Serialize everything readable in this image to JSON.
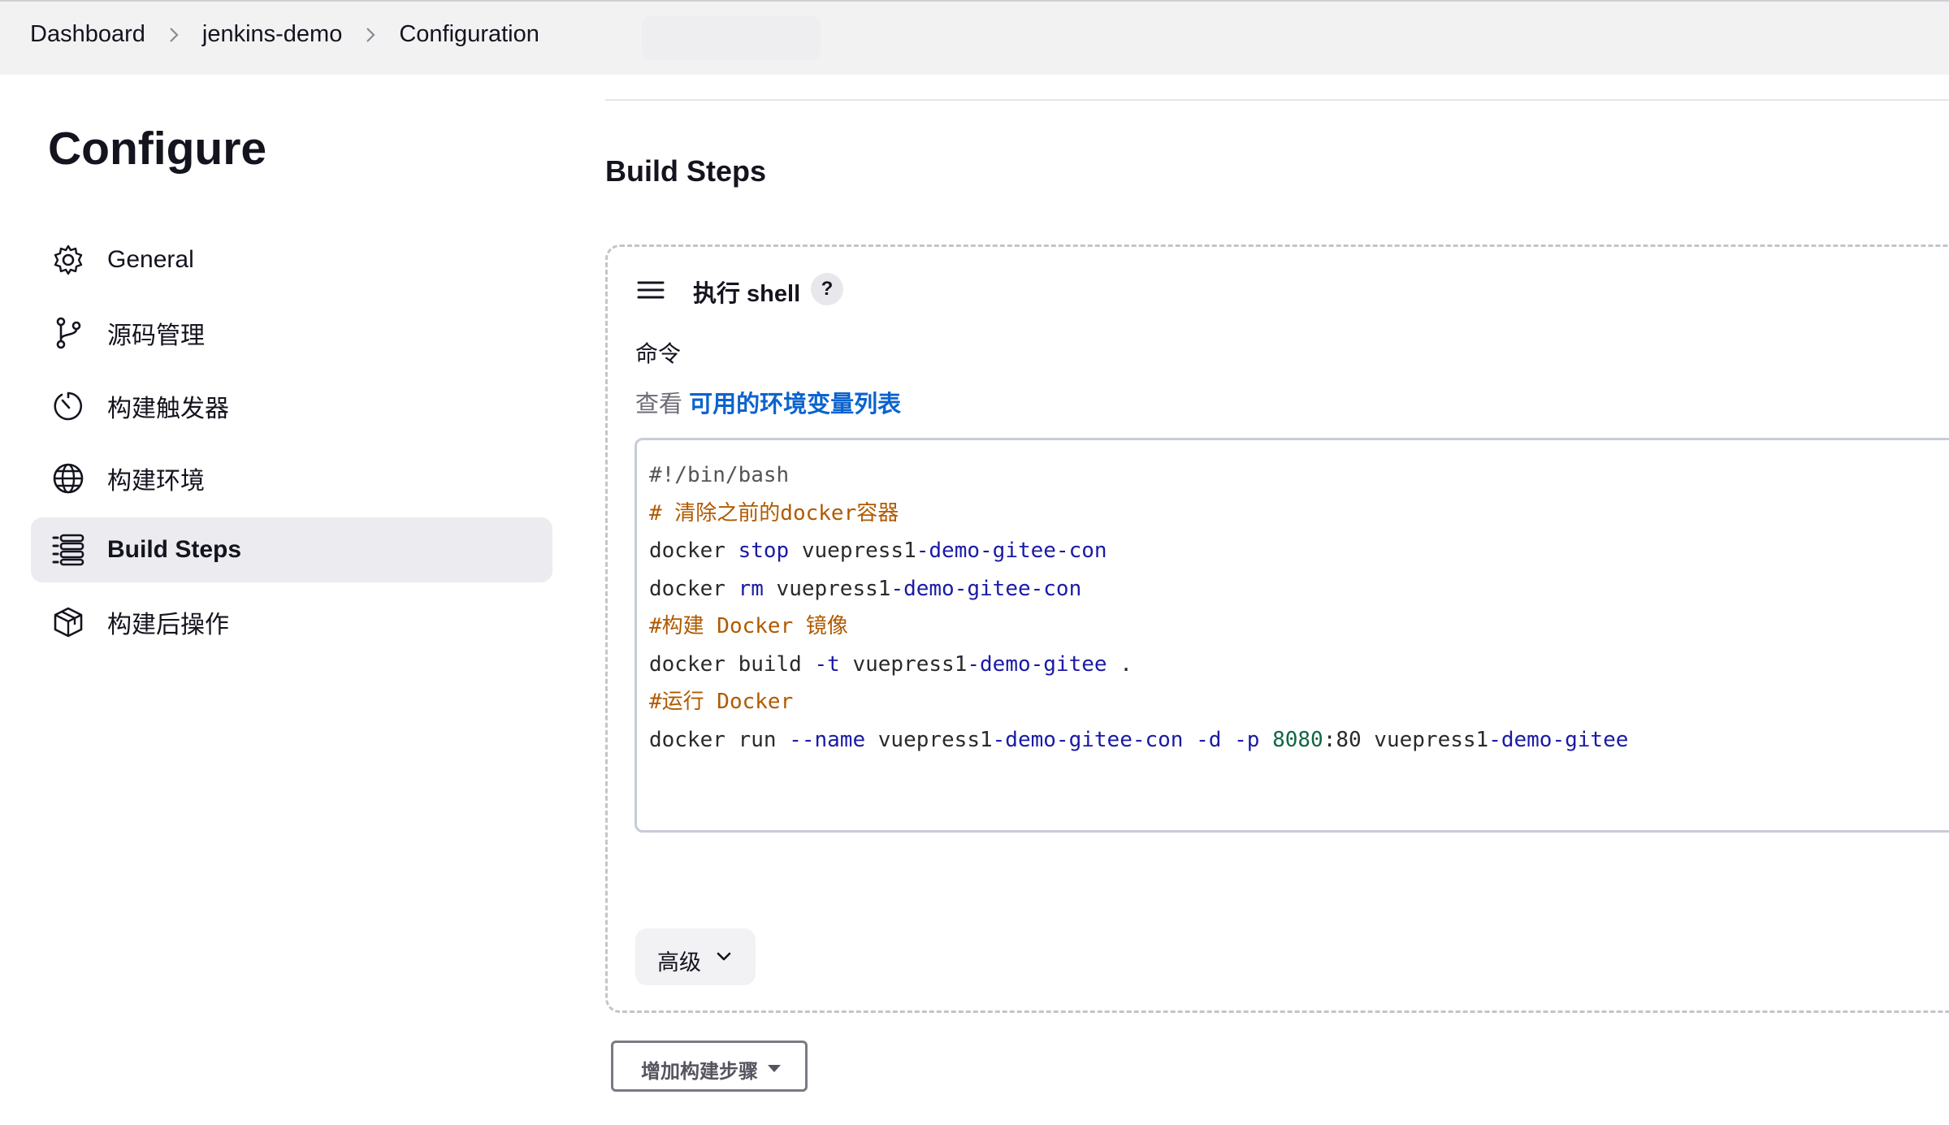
{
  "breadcrumb": {
    "items": [
      "Dashboard",
      "jenkins-demo",
      "Configuration"
    ]
  },
  "sidebar": {
    "title": "Configure",
    "items": [
      {
        "label": "General",
        "icon": "gear-icon"
      },
      {
        "label": "源码管理",
        "icon": "branch-icon"
      },
      {
        "label": "构建触发器",
        "icon": "clock-icon"
      },
      {
        "label": "构建环境",
        "icon": "globe-icon"
      },
      {
        "label": "Build Steps",
        "icon": "list-icon",
        "active": true
      },
      {
        "label": "构建后操作",
        "icon": "package-icon"
      }
    ]
  },
  "main": {
    "section_title": "Build Steps",
    "step": {
      "title": "执行 shell",
      "help": "?",
      "command_label": "命令",
      "env_prefix": "查看",
      "env_link": "可用的环境变量列表",
      "code_lines": [
        "#!/bin/bash",
        "# 清除之前的docker容器",
        "docker stop vuepress1-demo-gitee-con",
        "docker rm vuepress1-demo-gitee-con",
        "#构建 Docker 镜像",
        "docker build -t vuepress1-demo-gitee .",
        "#运行 Docker",
        "docker run --name vuepress1-demo-gitee-con -d -p 8080:80 vuepress1-demo-gitee"
      ],
      "advanced_label": "高级"
    },
    "add_step_label": "增加构建步骤"
  },
  "colors": {
    "accent_link": "#0b63ce",
    "active_item_bg": "#ebebf0",
    "comment": "#b05a00",
    "keyword": "#1a1aa6"
  }
}
